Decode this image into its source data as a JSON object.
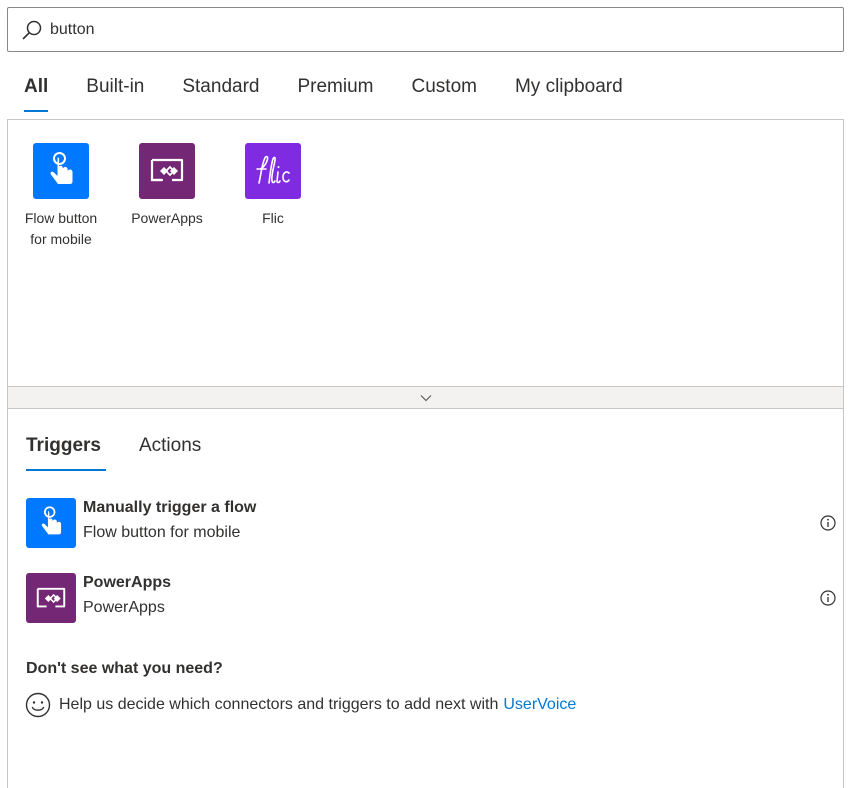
{
  "search": {
    "value": "button",
    "icon": "search-icon"
  },
  "top_tabs": [
    {
      "label": "All",
      "active": true
    },
    {
      "label": "Built-in",
      "active": false
    },
    {
      "label": "Standard",
      "active": false
    },
    {
      "label": "Premium",
      "active": false
    },
    {
      "label": "Custom",
      "active": false
    },
    {
      "label": "My clipboard",
      "active": false
    }
  ],
  "connectors": [
    {
      "label_line1": "Flow button",
      "label_line2": "for mobile",
      "icon": "touch-hand-icon",
      "color": "#0078ff"
    },
    {
      "label_line1": "PowerApps",
      "label_line2": "",
      "icon": "powerapps-icon",
      "color": "#742774"
    },
    {
      "label_line1": "Flic",
      "label_line2": "",
      "icon": "flic-icon",
      "color": "#7f2be1"
    }
  ],
  "sub_tabs": [
    {
      "label": "Triggers",
      "active": true
    },
    {
      "label": "Actions",
      "active": false
    }
  ],
  "triggers": [
    {
      "title": "Manually trigger a flow",
      "subtitle": "Flow button for mobile",
      "icon": "touch-hand-icon",
      "color": "#0078ff"
    },
    {
      "title": "PowerApps",
      "subtitle": "PowerApps",
      "icon": "powerapps-icon",
      "color": "#742774"
    }
  ],
  "help": {
    "title": "Don't see what you need?",
    "text": "Help us decide which connectors and triggers to add next with",
    "link": "UserVoice"
  },
  "colors": {
    "accent": "#0078d4",
    "flow_button": "#0078ff",
    "powerapps": "#742774",
    "flic": "#7f2be1"
  }
}
